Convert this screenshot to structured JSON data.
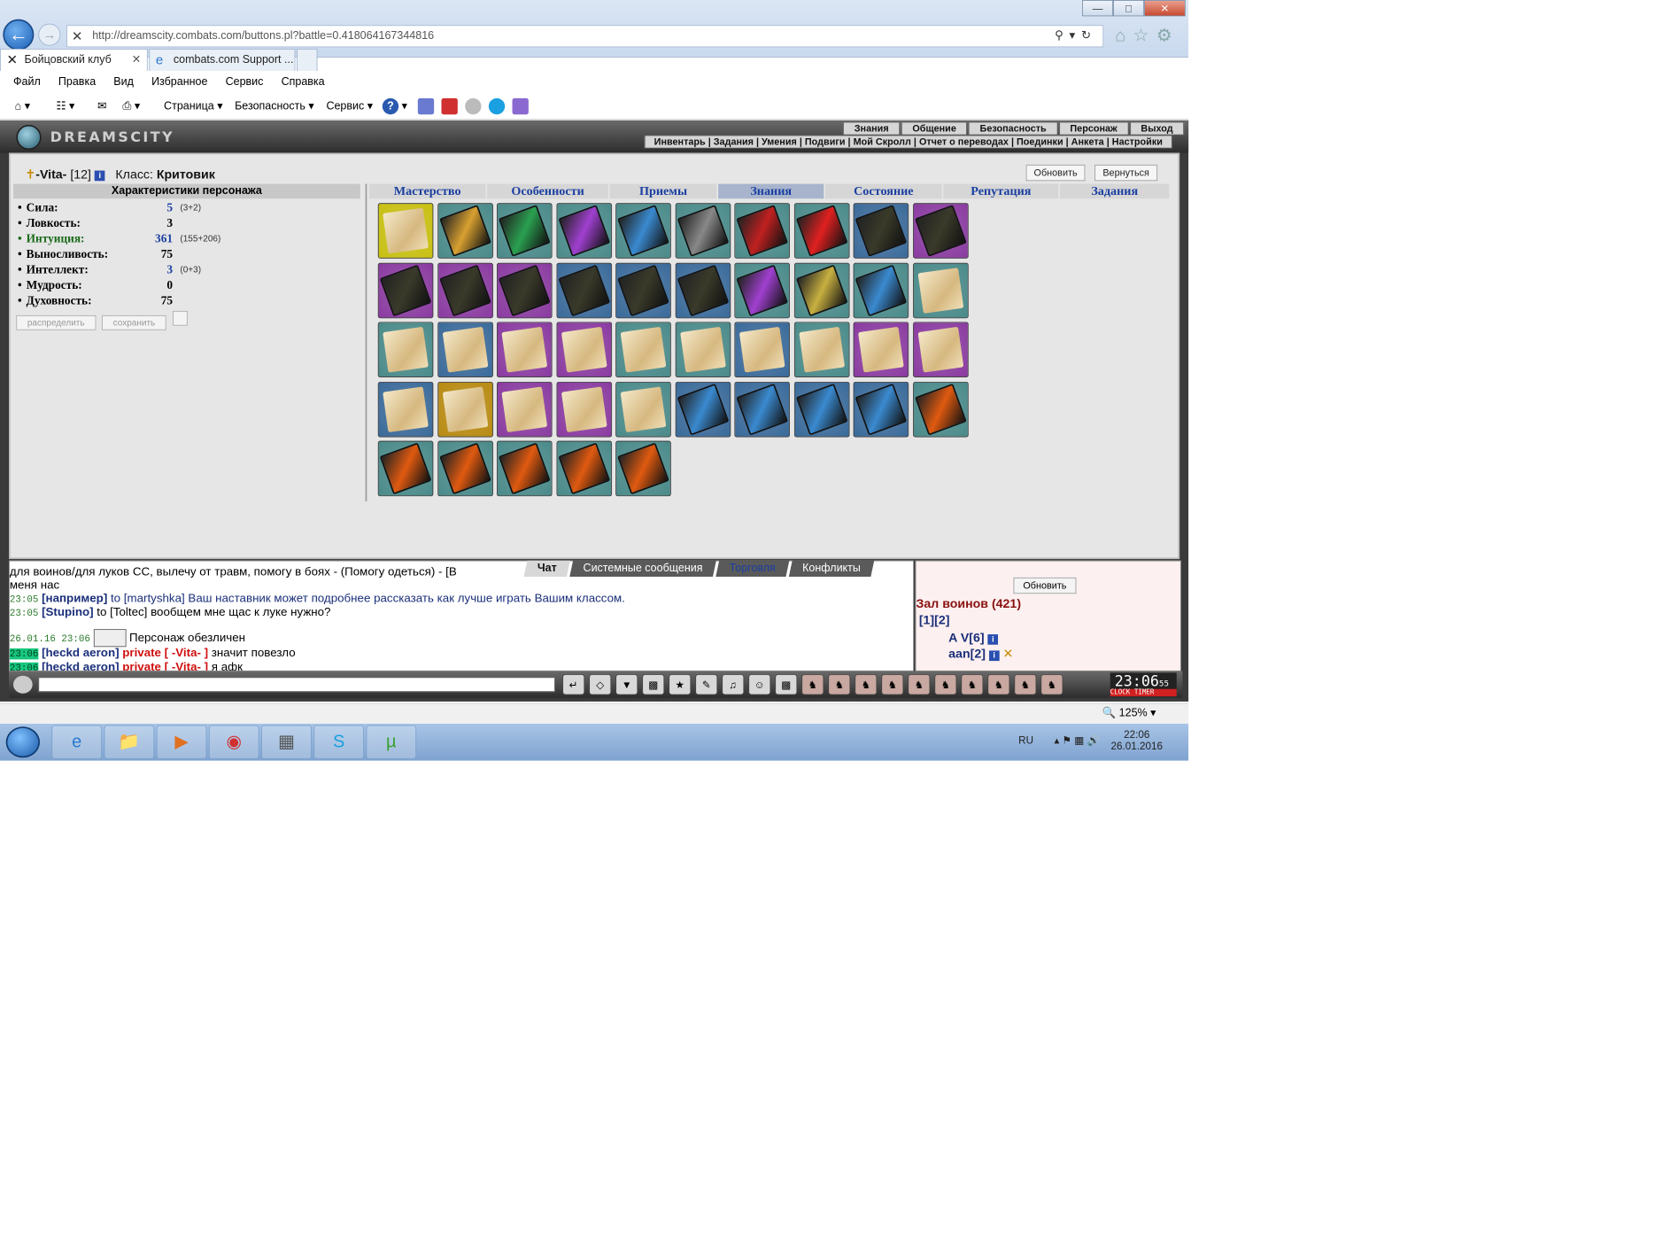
{
  "browser": {
    "url": "http://dreamscity.combats.com/buttons.pl?battle=0.418064167344816",
    "tabs": [
      "Бойцовский клуб",
      "combats.com Support ..."
    ],
    "menu": [
      "Файл",
      "Правка",
      "Вид",
      "Избранное",
      "Сервис",
      "Справка"
    ],
    "cmd": [
      "Страница",
      "Безопасность",
      "Сервис"
    ],
    "zoom": "125%"
  },
  "game": {
    "logo": "DREAMSCITY",
    "topnav": [
      "Знания",
      "Общение",
      "Безопасность",
      "Персонаж",
      "Выход"
    ],
    "subnav": "Инвентарь | Задания | Умения | Подвиги | Мой Скролл | Отчет о переводах | Поединки | Анкета | Настройки",
    "charname": "-Vita-",
    "level": "[12]",
    "class_label": "Класс:",
    "class": "Критовик",
    "btn_refresh": "Обновить",
    "btn_return": "Вернуться",
    "char_header": "Характеристики персонажа",
    "stats": [
      {
        "label": "Сила:",
        "value": "5",
        "extra": "(3+2)"
      },
      {
        "label": "Ловкость:",
        "value": "3",
        "extra": ""
      },
      {
        "label": "Интуиция:",
        "value": "361",
        "extra": "(155+206)"
      },
      {
        "label": "Выносливость:",
        "value": "75",
        "extra": ""
      },
      {
        "label": "Интеллект:",
        "value": "3",
        "extra": "(0+3)"
      },
      {
        "label": "Мудрость:",
        "value": "0",
        "extra": ""
      },
      {
        "label": "Духовность:",
        "value": "75",
        "extra": ""
      }
    ],
    "btn_distribute": "распределить",
    "btn_save": "сохранить",
    "tabs": [
      "Мастерство",
      "Особенности",
      "Приемы",
      "Знания",
      "Состояние",
      "Репутация",
      "Задания"
    ],
    "active_tab": "Знания"
  },
  "chat": {
    "tabs": [
      "Чат",
      "Системные сообщения",
      "Торговля",
      "Конфликты"
    ],
    "lines": [
      {
        "time": "",
        "text": "для воинов/для луков СС, вылечу от травм, помогу в боях - (Помогу одеться) - [В"
      },
      {
        "time": "",
        "text": "меня нас"
      },
      {
        "time": "23:05",
        "nick": "[например]",
        "text": " to [martyshka] Ваш наставник может подробнее рассказать как лучше играть Вашим классом."
      },
      {
        "time": "23:05",
        "nick": "[Stupino]",
        "text": " to [Toltec] вообщем мне щас к луке нужно?"
      },
      {
        "time": "26.01.16 23:06",
        "text": "Персонаж обезличен"
      },
      {
        "time": "23:06",
        "nick": "[heckd aeron]",
        "priv": " private [ -Vita- ]",
        "text": " значит повезло"
      },
      {
        "time": "23:06",
        "nick": "[heckd aeron]",
        "priv": " private [ -Vita- ]",
        "text": " я афк"
      }
    ]
  },
  "room": {
    "btn": "Обновить",
    "title": "Зал воинов (421)",
    "pages": "[1][2]",
    "players": [
      "A V[6]",
      "aan[2]"
    ]
  },
  "clock": {
    "time": "23:06",
    "sec": "55",
    "label": "CLOCK TIMER"
  },
  "taskbar": {
    "lang": "RU",
    "time": "22:06",
    "date": "26.01.2016"
  }
}
